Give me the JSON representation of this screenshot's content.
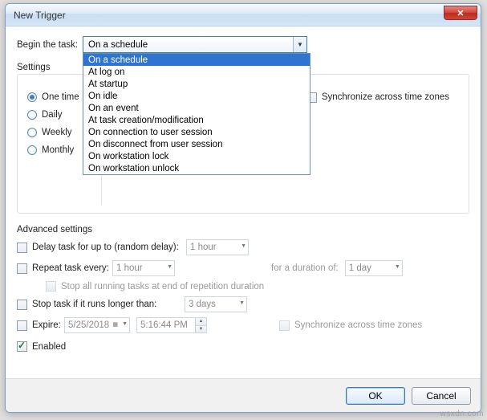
{
  "window": {
    "title": "New Trigger"
  },
  "begin": {
    "label": "Begin the task:",
    "selected": "On a schedule",
    "options": [
      "On a schedule",
      "At log on",
      "At startup",
      "On idle",
      "On an event",
      "At task creation/modification",
      "On connection to user session",
      "On disconnect from user session",
      "On workstation lock",
      "On workstation unlock"
    ]
  },
  "settings": {
    "label": "Settings",
    "schedule": {
      "one_time": "One time",
      "daily": "Daily",
      "weekly": "Weekly",
      "monthly": "Monthly",
      "selected": "one_time"
    },
    "sync_tz": "Synchronize across time zones"
  },
  "advanced": {
    "title": "Advanced settings",
    "delay": {
      "label": "Delay task for up to (random delay):",
      "value": "1 hour"
    },
    "repeat": {
      "label": "Repeat task every:",
      "value": "1 hour",
      "duration_label": "for a duration of:",
      "duration_value": "1 day",
      "stop_end": "Stop all running tasks at end of repetition duration"
    },
    "stop_if": {
      "label": "Stop task if it runs longer than:",
      "value": "3 days"
    },
    "expire": {
      "label": "Expire:",
      "date": "5/25/2018",
      "time": "5:16:44 PM",
      "sync_tz": "Synchronize across time zones"
    },
    "enabled": {
      "label": "Enabled",
      "checked": true
    }
  },
  "buttons": {
    "ok": "OK",
    "cancel": "Cancel"
  },
  "watermark": "wsxdn.com"
}
